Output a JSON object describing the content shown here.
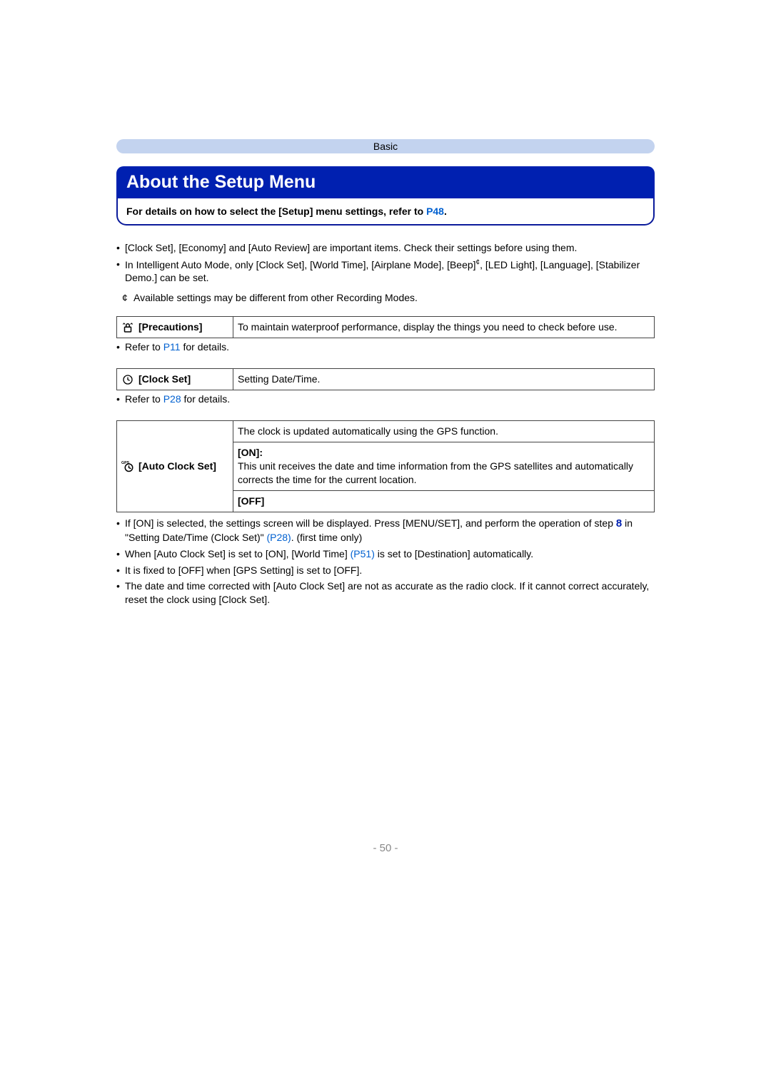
{
  "header": "Basic",
  "title": "About the Setup Menu",
  "subtitle": {
    "text_pre": "For details on how to select the [Setup] menu settings, refer to ",
    "link": "P48",
    "text_post": "."
  },
  "intro_bullets": [
    "[Clock Set], [Economy] and [Auto Review] are important items. Check their settings before using them.",
    "In Intelligent Auto Mode, only [Clock Set], [World Time], [Airplane Mode], [Beep]¢, [LED Light], [Language], [Stabilizer Demo.] can be set."
  ],
  "star_note": "Available settings may be different from other Recording Modes.",
  "precautions": {
    "icon": "precautions-icon",
    "label": "[Precautions]",
    "desc": "To maintain waterproof performance, display the things you need to check before use.",
    "refer_pre": "Refer to ",
    "refer_link": "P11",
    "refer_post": " for details."
  },
  "clockset": {
    "icon": "clock-icon",
    "label": "[Clock Set]",
    "desc": "Setting Date/Time.",
    "refer_pre": "Refer to ",
    "refer_link": "P28",
    "refer_post": " for details."
  },
  "autoclock": {
    "icon": "gps-clock-icon",
    "label": "[Auto Clock Set]",
    "desc": "The clock is updated automatically using the GPS function.",
    "on_label": "[ON]:",
    "on_desc": "This unit receives the date and time information from the GPS satellites and automatically corrects the time for the current location.",
    "off_label": "[OFF]"
  },
  "autoclock_notes": [
    {
      "pre": "If [ON] is selected, the settings screen will be displayed. Press [MENU/SET], and perform the operation of step ",
      "step": "8",
      "mid": " in \"Setting Date/Time (Clock Set)\" ",
      "link": "(P28)",
      "post": ". (first time only)"
    },
    {
      "pre": "When [Auto Clock Set] is set to [ON], [World Time] ",
      "link": "(P51)",
      "post": " is set to [Destination] automatically."
    },
    {
      "pre": "It is fixed to [OFF] when [GPS Setting] is set to [OFF]."
    },
    {
      "pre": "The date and time corrected with [Auto Clock Set] are not as accurate as the radio clock. If it cannot correct accurately, reset the clock using [Clock Set]."
    }
  ],
  "page_number": "- 50 -"
}
